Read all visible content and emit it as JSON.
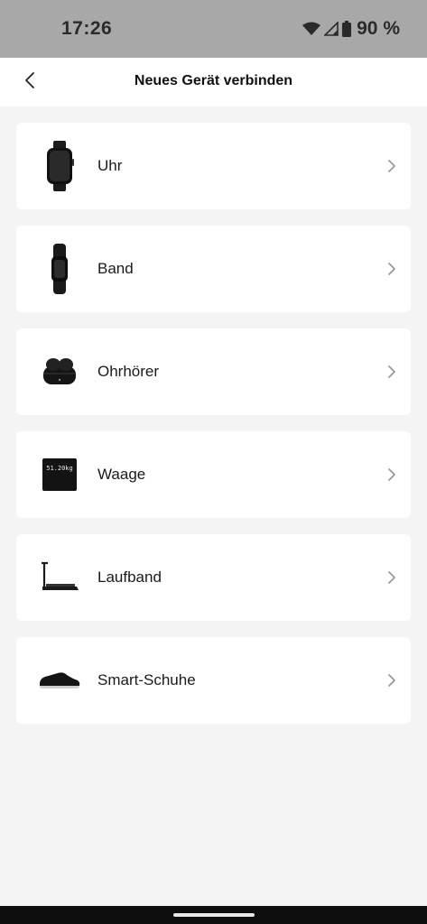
{
  "status_bar": {
    "time": "17:26",
    "battery": "90 %",
    "icons": [
      "wifi-icon",
      "signal-icon",
      "battery-icon"
    ]
  },
  "header": {
    "title": "Neues Gerät verbinden",
    "back_icon": "back-arrow-icon"
  },
  "devices": [
    {
      "label": "Uhr",
      "icon": "watch-icon"
    },
    {
      "label": "Band",
      "icon": "fitness-band-icon"
    },
    {
      "label": "Ohrhörer",
      "icon": "earbuds-icon"
    },
    {
      "label": "Waage",
      "icon": "scale-icon",
      "icon_text": "51.20kg"
    },
    {
      "label": "Laufband",
      "icon": "treadmill-icon"
    },
    {
      "label": "Smart-Schuhe",
      "icon": "shoe-icon"
    }
  ],
  "colors": {
    "status_bar_bg": "#a8a8a8",
    "page_bg": "#f4f4f4",
    "card_bg": "#ffffff",
    "text": "#1a1a1a",
    "chevron": "#9a9a9a"
  }
}
